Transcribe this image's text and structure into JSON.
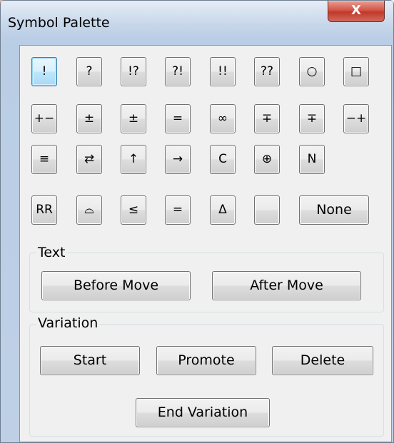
{
  "window": {
    "title": "Symbol Palette",
    "close_symbol": "X"
  },
  "symbols": {
    "row1": [
      "!",
      "?",
      "!?",
      "?!",
      "!!",
      "??",
      "○",
      "□"
    ],
    "row2": [
      "+−",
      "±",
      "±",
      "=",
      "∞",
      "∓",
      "∓",
      "−+"
    ],
    "row3": [
      "≡",
      "⇄",
      "↑",
      "→",
      "C",
      "⊕",
      "N"
    ],
    "row4": [
      "RR",
      "⌓",
      "≤",
      "=",
      "Δ",
      "",
      "None"
    ]
  },
  "text_group": {
    "label": "Text",
    "before_move": "Before Move",
    "after_move": "After Move"
  },
  "variation_group": {
    "label": "Variation",
    "start": "Start",
    "promote": "Promote",
    "delete": "Delete",
    "end_variation": "End Variation"
  }
}
